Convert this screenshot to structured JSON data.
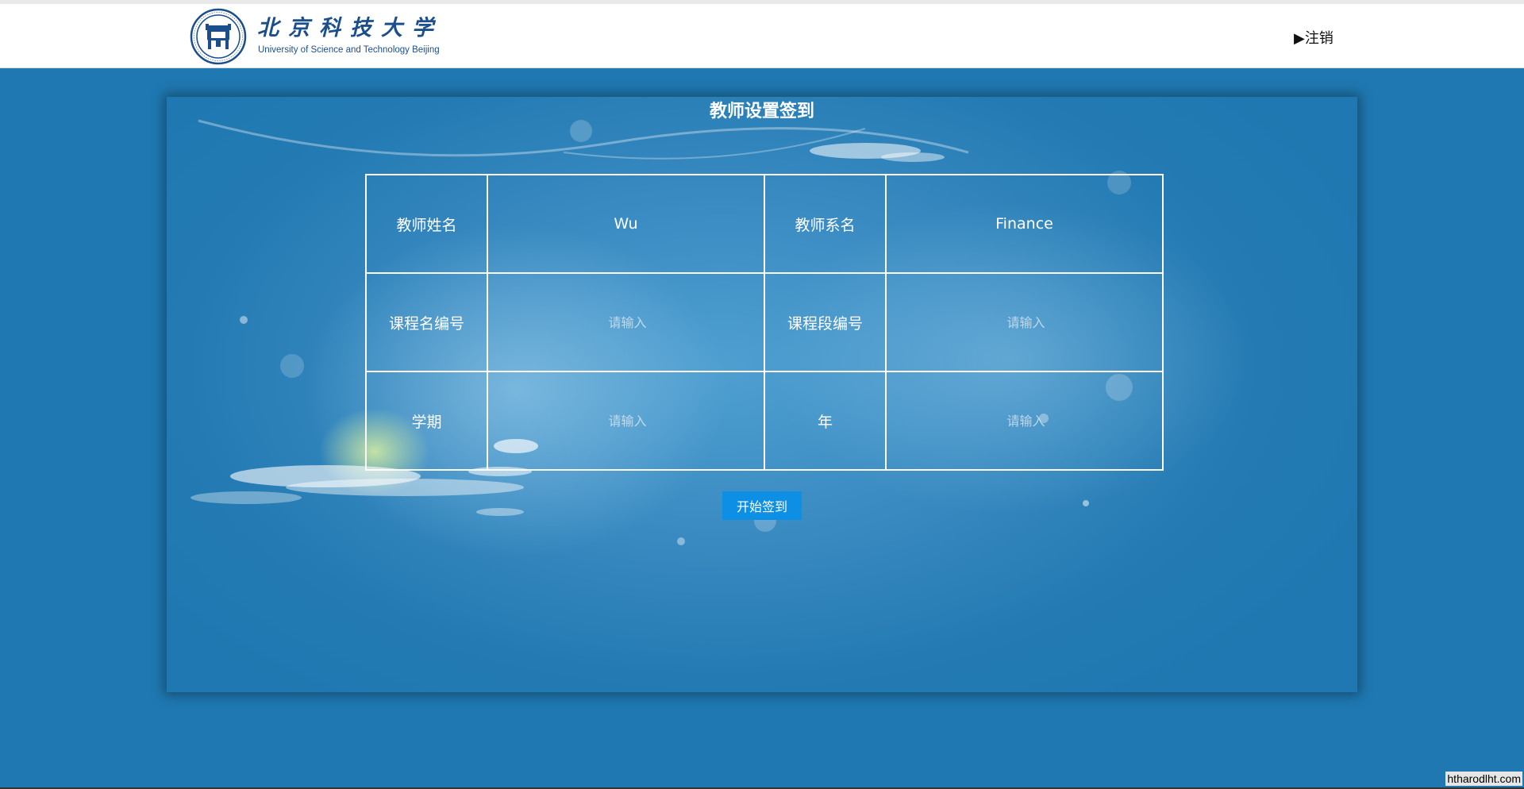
{
  "header": {
    "logo_title": "北京科技大学",
    "logo_subtitle": "University of Science and Technology Beijing",
    "logout_label": "▶注销"
  },
  "panel": {
    "title": "教师设置签到",
    "rows": [
      [
        {
          "kind": "label",
          "text": "教师姓名"
        },
        {
          "kind": "value",
          "text": "Wu"
        },
        {
          "kind": "label",
          "text": "教师系名"
        },
        {
          "kind": "value",
          "text": "Finance"
        }
      ],
      [
        {
          "kind": "label",
          "text": "课程名编号"
        },
        {
          "kind": "input",
          "value": "",
          "placeholder": "请输入"
        },
        {
          "kind": "label",
          "text": "课程段编号"
        },
        {
          "kind": "input",
          "value": "",
          "placeholder": "请输入"
        }
      ],
      [
        {
          "kind": "label",
          "text": "学期"
        },
        {
          "kind": "input",
          "value": "",
          "placeholder": "请输入"
        },
        {
          "kind": "label",
          "text": "年"
        },
        {
          "kind": "input",
          "value": "",
          "placeholder": "请输入"
        }
      ]
    ],
    "start_button_label": "开始签到"
  },
  "watermark": "htharodlht.com",
  "colors": {
    "page_background": "#1f78b1",
    "button": "#0d8fe6",
    "logo_blue": "#1b4f8c"
  }
}
